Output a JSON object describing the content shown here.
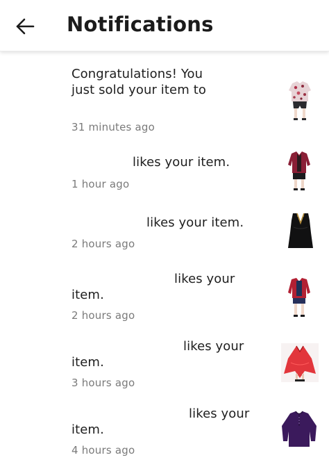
{
  "header": {
    "back_icon": "arrow-left-icon",
    "title": "Notifications"
  },
  "notifications": [
    {
      "text": "Congratulations! You just sold your item to",
      "time": "31 minutes ago",
      "thumbnail": "floral-blouse-outfit-image"
    },
    {
      "text": "likes your item.",
      "time": "1 hour ago",
      "thumbnail": "burgundy-jacket-outfit-image"
    },
    {
      "text": "likes your item.",
      "time": "2 hours ago",
      "thumbnail": "black-top-image"
    },
    {
      "text_line1": "likes your",
      "text_line2": "item.",
      "time": "2 hours ago",
      "thumbnail": "red-jacket-outfit-image"
    },
    {
      "text_line1": "likes your",
      "text_line2": "item.",
      "time": "3 hours ago",
      "thumbnail": "red-sheer-top-image"
    },
    {
      "text_line1": "likes your",
      "text_line2": "item.",
      "time": "4 hours ago",
      "thumbnail": "purple-henley-top-image"
    }
  ]
}
